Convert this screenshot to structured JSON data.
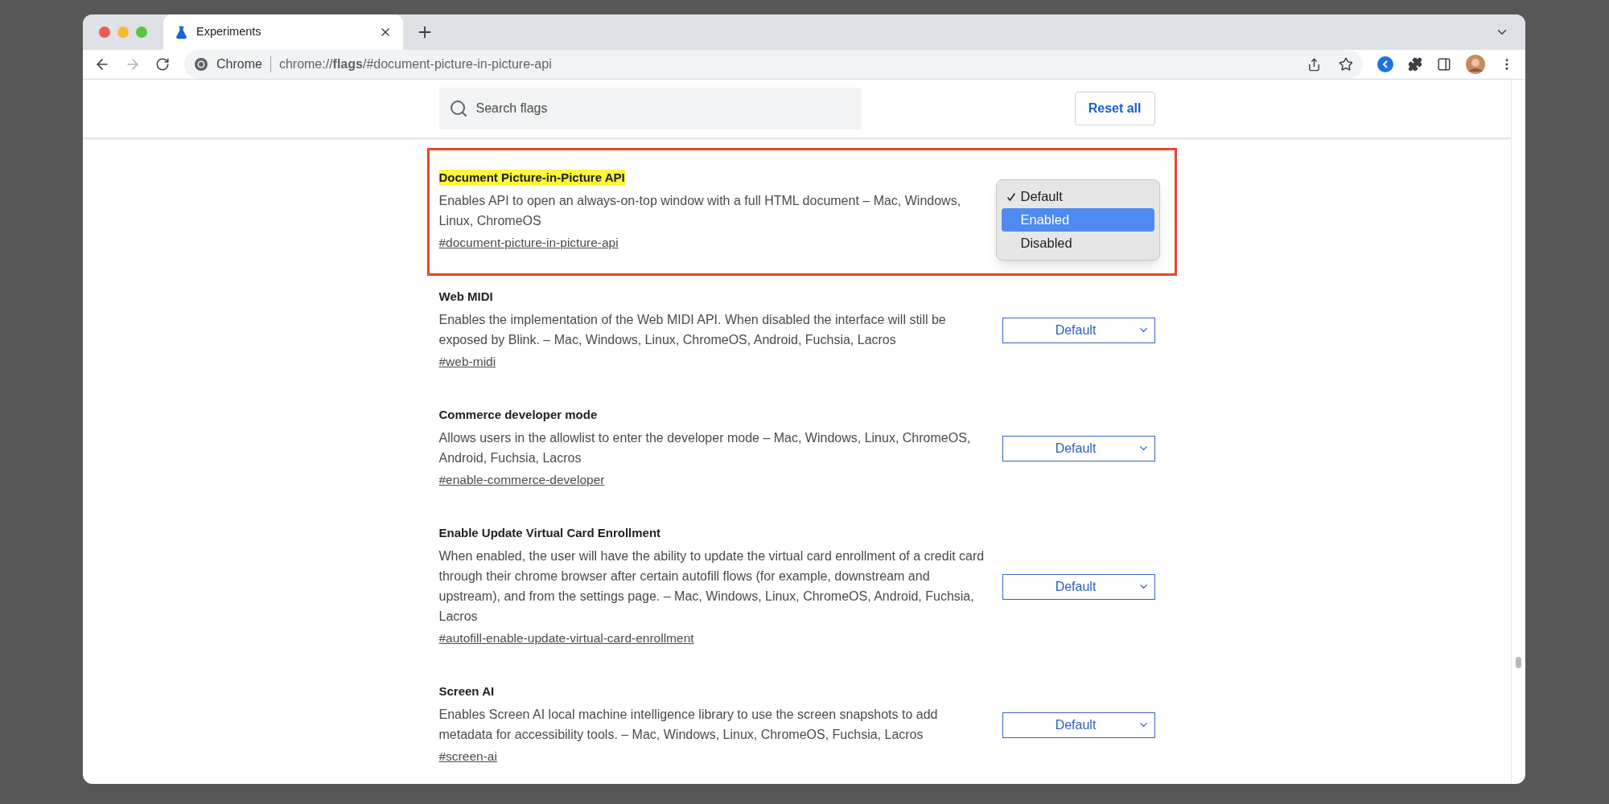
{
  "tab": {
    "title": "Experiments"
  },
  "omnibox": {
    "site": "Chrome",
    "url": "chrome://**flags**/#document-picture-in-picture-api"
  },
  "search": {
    "placeholder": "Search flags"
  },
  "reset_button": "Reset all",
  "flags": [
    {
      "title": "Document Picture-in-Picture API",
      "highlighted": true,
      "description": "Enables API to open an always-on-top window with a full HTML document – Mac, Windows, Linux, ChromeOS",
      "link": "#document-picture-in-picture-api",
      "menu": [
        {
          "label": "Default",
          "checked": true,
          "selected": false
        },
        {
          "label": "Enabled",
          "checked": false,
          "selected": true
        },
        {
          "label": "Disabled",
          "checked": false,
          "selected": false
        }
      ]
    },
    {
      "title": "Web MIDI",
      "highlighted": false,
      "description": "Enables the implementation of the Web MIDI API. When disabled the interface will still be exposed by Blink. – Mac, Windows, Linux, ChromeOS, Android, Fuchsia, Lacros",
      "link": "#web-midi",
      "value": "Default"
    },
    {
      "title": "Commerce developer mode",
      "highlighted": false,
      "description": "Allows users in the allowlist to enter the developer mode – Mac, Windows, Linux, ChromeOS, Android, Fuchsia, Lacros",
      "link": "#enable-commerce-developer",
      "value": "Default"
    },
    {
      "title": "Enable Update Virtual Card Enrollment",
      "highlighted": false,
      "description": "When enabled, the user will have the ability to update the virtual card enrollment of a credit card through their chrome browser after certain autofill flows (for example, downstream and upstream), and from the settings page. – Mac, Windows, Linux, ChromeOS, Android, Fuchsia, Lacros",
      "link": "#autofill-enable-update-virtual-card-enrollment",
      "value": "Default"
    },
    {
      "title": "Screen AI",
      "highlighted": false,
      "description": "Enables Screen AI local machine intelligence library to use the screen snapshots to add metadata for accessibility tools. – Mac, Windows, Linux, ChromeOS, Fuchsia, Lacros",
      "link": "#screen-ai",
      "value": "Default"
    }
  ]
}
